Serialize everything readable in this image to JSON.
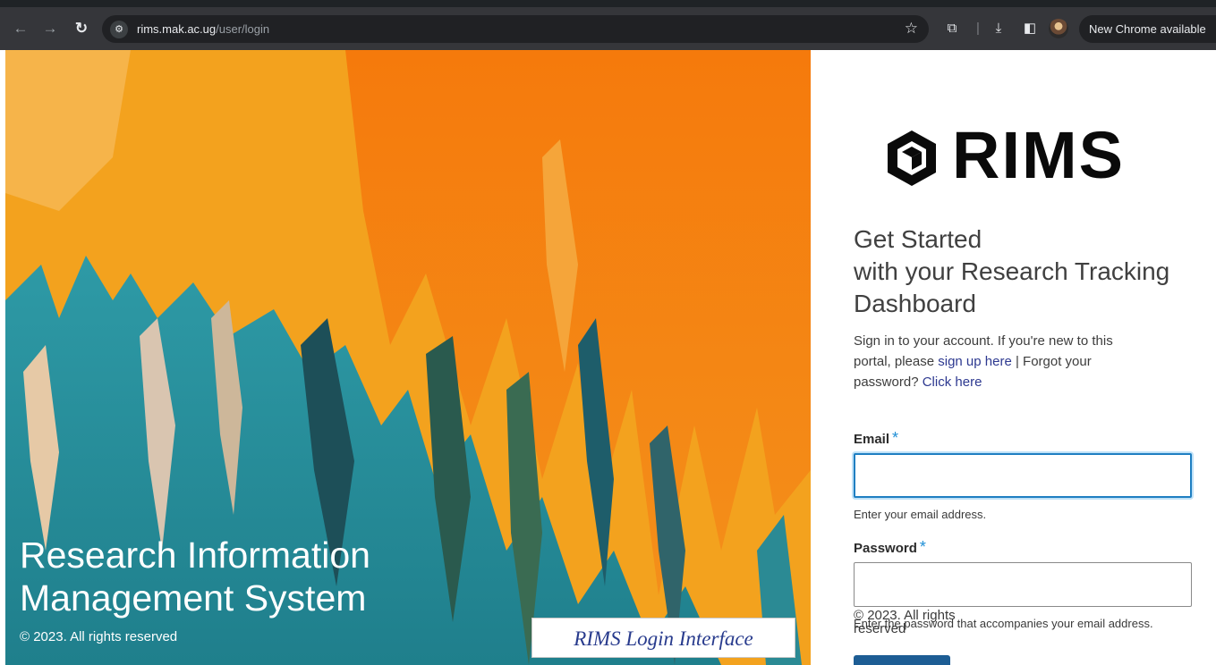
{
  "browser": {
    "nav": {
      "back_icon": "arrow-left-icon",
      "forward_icon": "arrow-right-icon",
      "reload_icon": "reload-icon"
    },
    "url_host": "rims.mak.ac.ug",
    "url_path": "/user/login",
    "update_label": "New Chrome available"
  },
  "hero": {
    "title_line1": "Research Information",
    "title_line2": "Management System",
    "copyright": "© 2023. All rights reserved",
    "caption": "RIMS Login Interface",
    "colors": {
      "orange": "#f38a12",
      "yellow": "#f4a31c",
      "teal": "#23808d"
    }
  },
  "login": {
    "logo_text": "RIMS",
    "heading_line1": "Get Started",
    "heading_line2": "with your Research Tracking",
    "heading_line3": "Dashboard",
    "intro_before": "Sign in to your account. If you're new to this portal, please ",
    "signup_link": "sign up here",
    "intro_middle": " | Forgot your password? ",
    "reset_link": "Click here",
    "email_label": "Email",
    "email_required": "*",
    "email_value": "",
    "email_help": "Enter your email address.",
    "password_label": "Password",
    "password_required": "*",
    "password_value": "",
    "password_help": "Enter the password that accompanies your email address.",
    "copyright": "© 2023. All rights reserved",
    "accent_color": "#1f7fc2",
    "link_color": "#2d3990"
  }
}
